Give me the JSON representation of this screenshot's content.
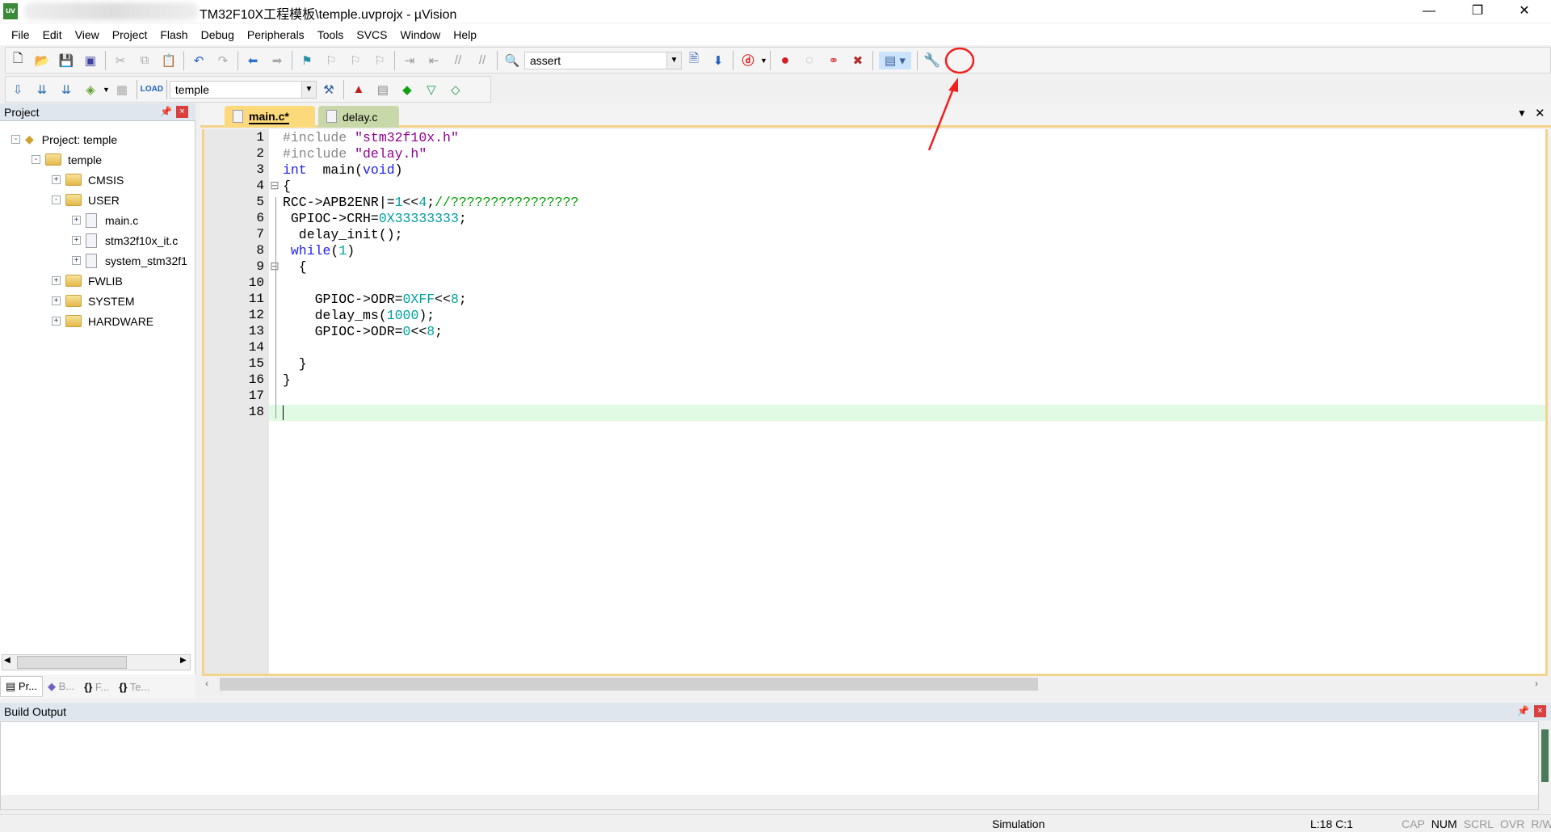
{
  "window": {
    "title": "TM32F10X工程模板\\temple.uvprojx - µVision",
    "app_icon": "uv"
  },
  "menu": [
    "File",
    "Edit",
    "View",
    "Project",
    "Flash",
    "Debug",
    "Peripherals",
    "Tools",
    "SVCS",
    "Window",
    "Help"
  ],
  "toolbar": {
    "find_value": "assert",
    "target_value": "temple"
  },
  "project": {
    "title": "Project",
    "tree": [
      {
        "label": "Project: temple",
        "level": 0,
        "type": "project",
        "exp": "-"
      },
      {
        "label": "temple",
        "level": 1,
        "type": "target",
        "exp": "-"
      },
      {
        "label": "CMSIS",
        "level": 2,
        "type": "folder",
        "exp": "+"
      },
      {
        "label": "USER",
        "level": 2,
        "type": "folder",
        "exp": "-"
      },
      {
        "label": "main.c",
        "level": 3,
        "type": "file",
        "exp": "+"
      },
      {
        "label": "stm32f10x_it.c",
        "level": 3,
        "type": "file",
        "exp": "+"
      },
      {
        "label": "system_stm32f1",
        "level": 3,
        "type": "file",
        "exp": "+"
      },
      {
        "label": "FWLIB",
        "level": 2,
        "type": "folder",
        "exp": "+"
      },
      {
        "label": "SYSTEM",
        "level": 2,
        "type": "folder",
        "exp": "+"
      },
      {
        "label": "HARDWARE",
        "level": 2,
        "type": "folder",
        "exp": "+"
      }
    ],
    "bottom_tabs": [
      "Pr...",
      "B...",
      "F...",
      "Te..."
    ]
  },
  "editor": {
    "tabs": [
      {
        "label": "main.c*",
        "active": true
      },
      {
        "label": "delay.c",
        "active": false
      }
    ],
    "current_line": 18,
    "lines": [
      [
        [
          "p",
          "#include "
        ],
        [
          "s",
          "\"stm32f10x.h\""
        ]
      ],
      [
        [
          "p",
          "#include "
        ],
        [
          "s",
          "\"delay.h\""
        ]
      ],
      [
        [
          "k",
          "int"
        ],
        [
          "",
          "  main("
        ],
        [
          "k",
          "void"
        ],
        [
          "",
          ")"
        ]
      ],
      [
        [
          "",
          "{"
        ]
      ],
      [
        [
          "",
          "RCC->APB2ENR|="
        ],
        [
          "n",
          "1"
        ],
        [
          "",
          "<<"
        ],
        [
          "n",
          "4"
        ],
        [
          "",
          ";"
        ],
        [
          "c",
          "//????????????????"
        ]
      ],
      [
        [
          "",
          " GPIOC->CRH="
        ],
        [
          "n",
          "0X33333333"
        ],
        [
          "",
          ";"
        ]
      ],
      [
        [
          "",
          "  delay_init();"
        ]
      ],
      [
        [
          "k",
          " while"
        ],
        [
          "",
          "("
        ],
        [
          "n",
          "1"
        ],
        [
          "",
          ")"
        ]
      ],
      [
        [
          "",
          "  {"
        ]
      ],
      [],
      [
        [
          "",
          "    GPIOC->ODR="
        ],
        [
          "n",
          "0XFF"
        ],
        [
          "",
          "<<"
        ],
        [
          "n",
          "8"
        ],
        [
          "",
          ";"
        ]
      ],
      [
        [
          "",
          "    delay_ms("
        ],
        [
          "n",
          "1000"
        ],
        [
          "",
          ");"
        ]
      ],
      [
        [
          "",
          "    GPIOC->ODR="
        ],
        [
          "n",
          "0"
        ],
        [
          "",
          "<<"
        ],
        [
          "n",
          "8"
        ],
        [
          "",
          ";"
        ]
      ],
      [],
      [
        [
          "",
          "  }"
        ]
      ],
      [
        [
          "",
          "}"
        ]
      ],
      [],
      []
    ]
  },
  "build": {
    "title": "Build Output"
  },
  "status": {
    "mode": "Simulation",
    "position": "L:18 C:1",
    "keys": [
      "CAP",
      "NUM",
      "SCRL",
      "OVR",
      "R/W"
    ],
    "active_keys": [
      "NUM"
    ]
  },
  "annotation": {
    "color": "#f02020"
  }
}
